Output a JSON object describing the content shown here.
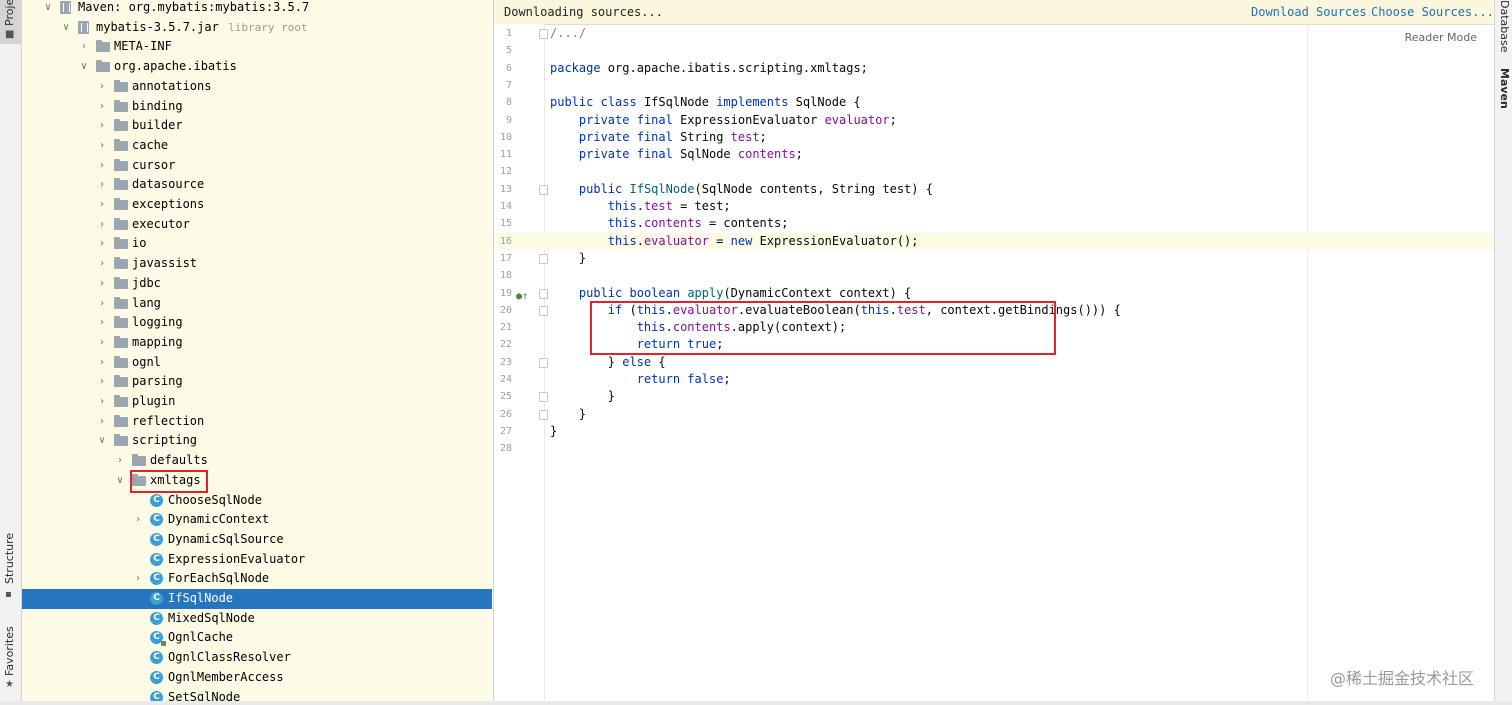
{
  "left_strip": {
    "project": "Project",
    "structure": "Structure",
    "favorites": "Favorites"
  },
  "right_strip": {
    "database": "Database",
    "maven": "Maven"
  },
  "tree": {
    "rows": [
      {
        "label": "Maven: org.mybatis:mybatis:3.5.7",
        "icon": "library-icon",
        "arrow": "down"
      },
      {
        "label": "mybatis-3.5.7.jar",
        "hint": "library root",
        "icon": "jar-icon",
        "arrow": "down"
      },
      {
        "label": "META-INF",
        "icon": "folder-icon",
        "arrow": "right"
      },
      {
        "label": "org.apache.ibatis",
        "icon": "folder-icon",
        "arrow": "down"
      },
      {
        "label": "annotations",
        "icon": "folder-icon",
        "arrow": "right"
      },
      {
        "label": "binding",
        "icon": "folder-icon",
        "arrow": "right"
      },
      {
        "label": "builder",
        "icon": "folder-icon",
        "arrow": "right"
      },
      {
        "label": "cache",
        "icon": "folder-icon",
        "arrow": "right"
      },
      {
        "label": "cursor",
        "icon": "folder-icon",
        "arrow": "right"
      },
      {
        "label": "datasource",
        "icon": "folder-icon",
        "arrow": "right"
      },
      {
        "label": "exceptions",
        "icon": "folder-icon",
        "arrow": "right"
      },
      {
        "label": "executor",
        "icon": "folder-icon",
        "arrow": "right"
      },
      {
        "label": "io",
        "icon": "folder-icon",
        "arrow": "right"
      },
      {
        "label": "javassist",
        "icon": "folder-icon",
        "arrow": "right"
      },
      {
        "label": "jdbc",
        "icon": "folder-icon",
        "arrow": "right"
      },
      {
        "label": "lang",
        "icon": "folder-icon",
        "arrow": "right"
      },
      {
        "label": "logging",
        "icon": "folder-icon",
        "arrow": "right"
      },
      {
        "label": "mapping",
        "icon": "folder-icon",
        "arrow": "right"
      },
      {
        "label": "ognl",
        "icon": "folder-icon",
        "arrow": "right"
      },
      {
        "label": "parsing",
        "icon": "folder-icon",
        "arrow": "right"
      },
      {
        "label": "plugin",
        "icon": "folder-icon",
        "arrow": "right"
      },
      {
        "label": "reflection",
        "icon": "folder-icon",
        "arrow": "right"
      },
      {
        "label": "scripting",
        "icon": "folder-icon",
        "arrow": "down"
      },
      {
        "label": "defaults",
        "icon": "folder-icon",
        "arrow": "right"
      },
      {
        "label": "xmltags",
        "icon": "folder-icon",
        "arrow": "down"
      },
      {
        "label": "ChooseSqlNode",
        "icon": "class-icon",
        "arrow": ""
      },
      {
        "label": "DynamicContext",
        "icon": "class-icon",
        "arrow": "right"
      },
      {
        "label": "DynamicSqlSource",
        "icon": "class-icon",
        "arrow": ""
      },
      {
        "label": "ExpressionEvaluator",
        "icon": "class-icon",
        "arrow": ""
      },
      {
        "label": "ForEachSqlNode",
        "icon": "class-icon",
        "arrow": "right"
      },
      {
        "label": "IfSqlNode",
        "icon": "class-icon",
        "arrow": "",
        "selected": true
      },
      {
        "label": "MixedSqlNode",
        "icon": "class-icon",
        "arrow": ""
      },
      {
        "label": "OgnlCache",
        "icon": "class-icon",
        "arrow": ""
      },
      {
        "label": "OgnlClassResolver",
        "icon": "class-icon",
        "arrow": ""
      },
      {
        "label": "OgnlMemberAccess",
        "icon": "class-icon",
        "arrow": ""
      },
      {
        "label": "SetSqlNode",
        "icon": "class-icon",
        "arrow": ""
      }
    ]
  },
  "editor": {
    "banner_text": "Downloading sources...",
    "download_sources": "Download Sources",
    "choose_sources": "Choose Sources...",
    "reader_mode": "Reader Mode",
    "lines": [
      {
        "n": "1",
        "text": "/.../",
        "fold": true
      },
      {
        "n": "5",
        "text": ""
      },
      {
        "n": "6",
        "text": "package org.apache.ibatis.scripting.xmltags;"
      },
      {
        "n": "7",
        "text": ""
      },
      {
        "n": "8",
        "text": "public class IfSqlNode implements SqlNode {"
      },
      {
        "n": "9",
        "text": "    private final ExpressionEvaluator evaluator;"
      },
      {
        "n": "10",
        "text": "    private final String test;"
      },
      {
        "n": "11",
        "text": "    private final SqlNode contents;"
      },
      {
        "n": "12",
        "text": ""
      },
      {
        "n": "13",
        "text": "    public IfSqlNode(SqlNode contents, String test) {",
        "fold": true
      },
      {
        "n": "14",
        "text": "        this.test = test;"
      },
      {
        "n": "15",
        "text": "        this.contents = contents;"
      },
      {
        "n": "16",
        "text": "        this.evaluator = new ExpressionEvaluator();",
        "current": true
      },
      {
        "n": "17",
        "text": "    }",
        "fold": true
      },
      {
        "n": "18",
        "text": ""
      },
      {
        "n": "19",
        "text": "    public boolean apply(DynamicContext context) {",
        "fold": true,
        "gutter_icon": "implements-icon"
      },
      {
        "n": "20",
        "text": "        if (this.evaluator.evaluateBoolean(this.test, context.getBindings())) {",
        "fold": true
      },
      {
        "n": "21",
        "text": "            this.contents.apply(context);"
      },
      {
        "n": "22",
        "text": "            return true;"
      },
      {
        "n": "23",
        "text": "        } else {",
        "fold": true
      },
      {
        "n": "24",
        "text": "            return false;"
      },
      {
        "n": "25",
        "text": "        }",
        "fold": true
      },
      {
        "n": "26",
        "text": "    }",
        "fold": true
      },
      {
        "n": "27",
        "text": "}"
      },
      {
        "n": "28",
        "text": ""
      }
    ]
  },
  "watermark": "@稀土掘金技术社区",
  "colors": {
    "tree_bg": "#fdfbe6",
    "selection": "#2675bf",
    "keyword": "#0033b3",
    "field": "#871094",
    "highlight_box": "#e0242b",
    "banner_bg": "#fbf7dc",
    "link": "#2470b3"
  }
}
